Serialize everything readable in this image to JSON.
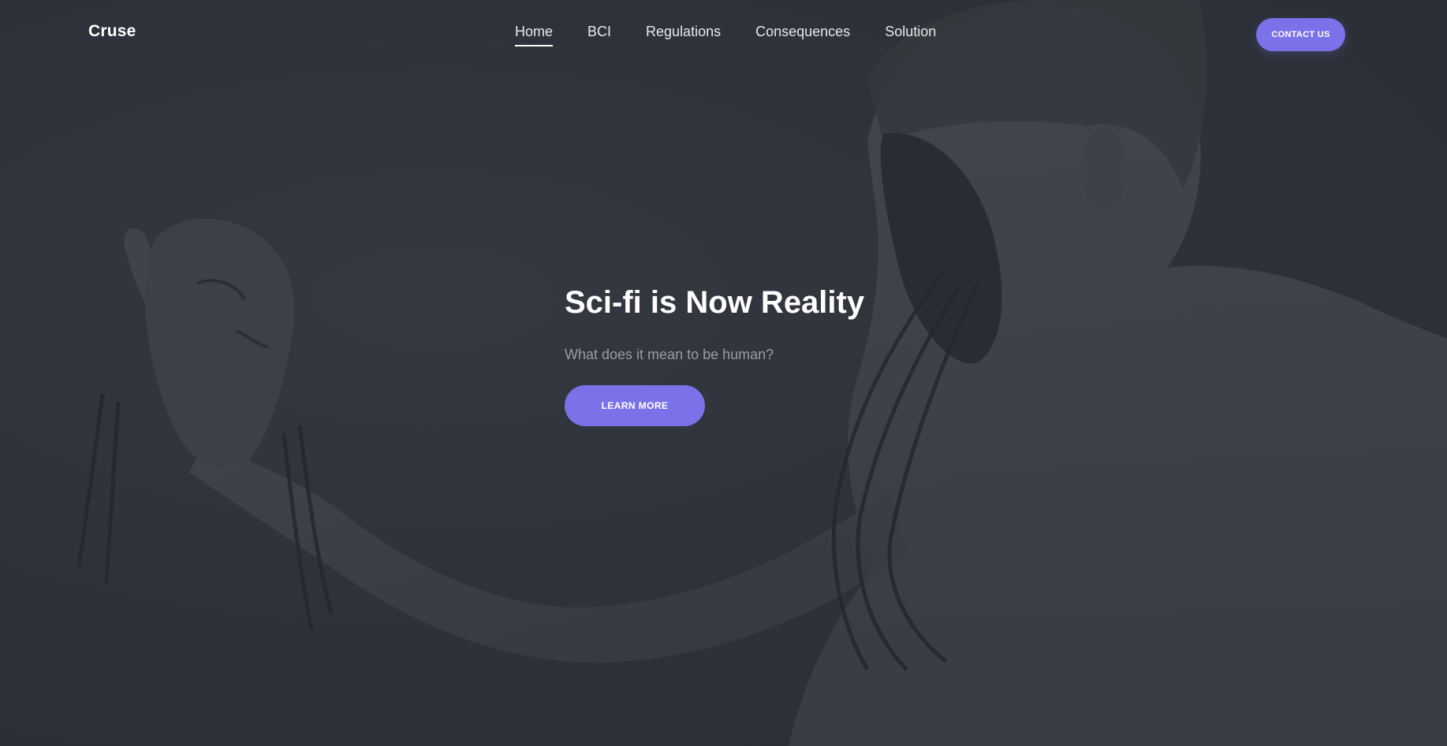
{
  "header": {
    "brand": "Cruse",
    "contact_label": "CONTACT US"
  },
  "nav": {
    "items": [
      {
        "label": "Home",
        "active": true
      },
      {
        "label": "BCI",
        "active": false
      },
      {
        "label": "Regulations",
        "active": false
      },
      {
        "label": "Consequences",
        "active": false
      },
      {
        "label": "Solution",
        "active": false
      }
    ]
  },
  "hero": {
    "title": "Sci-fi is Now Reality",
    "subtitle": "What does it mean to be human?",
    "cta_label": "LEARN MORE"
  },
  "colors": {
    "accent": "#7b72ea",
    "background": "#2f333b"
  }
}
